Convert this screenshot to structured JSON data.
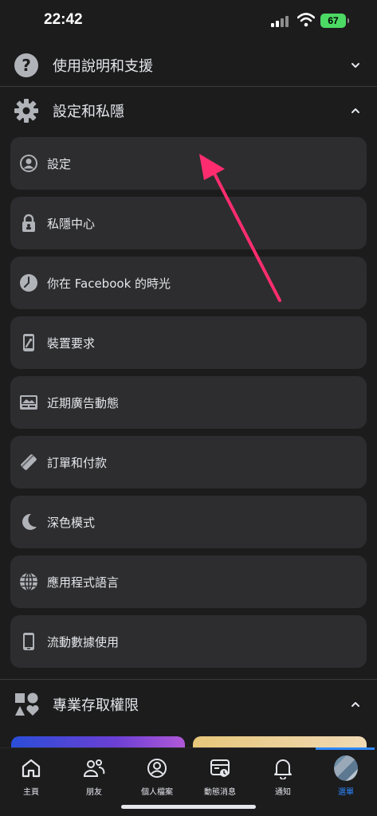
{
  "status_bar": {
    "time": "22:42",
    "battery": "67"
  },
  "sections": {
    "help": {
      "label": "使用說明和支援"
    },
    "settings": {
      "label": "設定和私隱"
    },
    "pro": {
      "label": "專業存取權限"
    }
  },
  "settings_items": [
    {
      "label": "設定",
      "icon": "account-circle-icon"
    },
    {
      "label": "私隱中心",
      "icon": "lock-icon"
    },
    {
      "label": "你在 Facebook 的時光",
      "icon": "clock-icon"
    },
    {
      "label": "裝置要求",
      "icon": "phone-device-icon"
    },
    {
      "label": "近期廣告動態",
      "icon": "ad-activity-icon"
    },
    {
      "label": "訂單和付款",
      "icon": "card-icon"
    },
    {
      "label": "深色模式",
      "icon": "moon-icon"
    },
    {
      "label": "應用程式語言",
      "icon": "globe-icon"
    },
    {
      "label": "流動數據使用",
      "icon": "mobile-data-icon"
    }
  ],
  "tabs": [
    {
      "label": "主頁",
      "icon": "home-icon"
    },
    {
      "label": "朋友",
      "icon": "friends-icon"
    },
    {
      "label": "個人檔案",
      "icon": "profile-icon"
    },
    {
      "label": "動態消息",
      "icon": "news-feed-icon"
    },
    {
      "label": "通知",
      "icon": "bell-icon"
    },
    {
      "label": "選單",
      "icon": "menu-avatar-icon"
    }
  ],
  "colors": {
    "accent": "#2d88ff",
    "annotation_arrow": "#ff2d6f",
    "background": "#1c1c1d",
    "item_bg": "#2d2d2f"
  }
}
